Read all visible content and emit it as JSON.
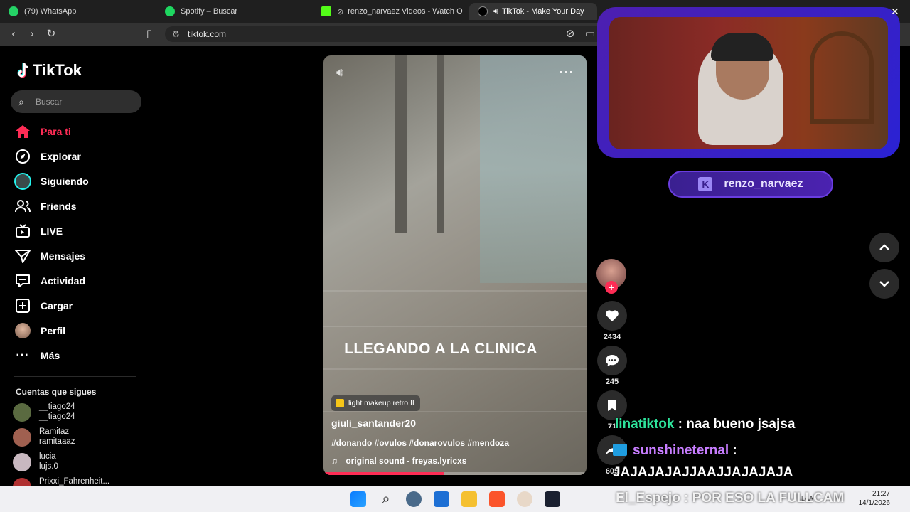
{
  "colors": {
    "accent": "#fe2c55",
    "brand_purple": "#4b22b0",
    "chat_green": "#2ee59d",
    "chat_purple": "#c77dff"
  },
  "browser": {
    "tabs": [
      {
        "title": "(79) WhatsApp",
        "icon": "whatsapp-icon"
      },
      {
        "title": "Spotify – Buscar",
        "icon": "spotify-icon"
      },
      {
        "title": "renzo_narvaez Videos - Watch O",
        "icon": "kick-icon"
      },
      {
        "title": "TikTok - Make Your Day",
        "icon": "tiktok-icon"
      }
    ],
    "url": "tiktok.com"
  },
  "sidebar": {
    "logo": "TikTok",
    "search_placeholder": "Buscar",
    "items": [
      {
        "label": "Para ti",
        "icon": "home-icon"
      },
      {
        "label": "Explorar",
        "icon": "compass-icon"
      },
      {
        "label": "Siguiendo",
        "icon": "following-avatar-icon"
      },
      {
        "label": "Friends",
        "icon": "friends-icon"
      },
      {
        "label": "LIVE",
        "icon": "live-icon"
      },
      {
        "label": "Mensajes",
        "icon": "send-icon"
      },
      {
        "label": "Actividad",
        "icon": "activity-icon"
      },
      {
        "label": "Cargar",
        "icon": "upload-icon"
      },
      {
        "label": "Perfil",
        "icon": "profile-avatar-icon"
      },
      {
        "label": "Más",
        "icon": "more-dots-icon"
      }
    ],
    "following_title": "Cuentas que sigues",
    "accounts": [
      {
        "name": "__tiago24",
        "handle": "__tiago24"
      },
      {
        "name": "Ramitaz",
        "handle": "ramitaaaz"
      },
      {
        "name": "lucia",
        "handle": "lujs.0"
      },
      {
        "name": "Prixxi_Fahrenheit...",
        "handle": ""
      }
    ]
  },
  "video": {
    "overlay_text": "LLEGANDO A LA CLINICA",
    "effect": "light makeup retro II",
    "author": "giuli_santander20",
    "hashtags": "#donando #ovulos #donarovulos #mendoza",
    "sound": "original sound - freyas.lyricxs",
    "progress": 0.46
  },
  "actions": {
    "likes": "2434",
    "comments": "245",
    "saves": "71",
    "shares": "605"
  },
  "stream": {
    "streamer": "renzo_narvaez",
    "chat": [
      {
        "user": "linatiktok",
        "sep": " : ",
        "message": "naa bueno jsajsa"
      },
      {
        "user": "sunshineternal",
        "sep": " :",
        "message": ""
      },
      {
        "user": "",
        "sep": "",
        "message": "JAJAJAJAJJAAJJAJAJAJA"
      }
    ],
    "overlay_message": "El_Espejo : POR ESO LA FULLCAM"
  },
  "taskbar": {
    "time": "21:27",
    "date": "14/1/2026",
    "lang": "LAA"
  }
}
